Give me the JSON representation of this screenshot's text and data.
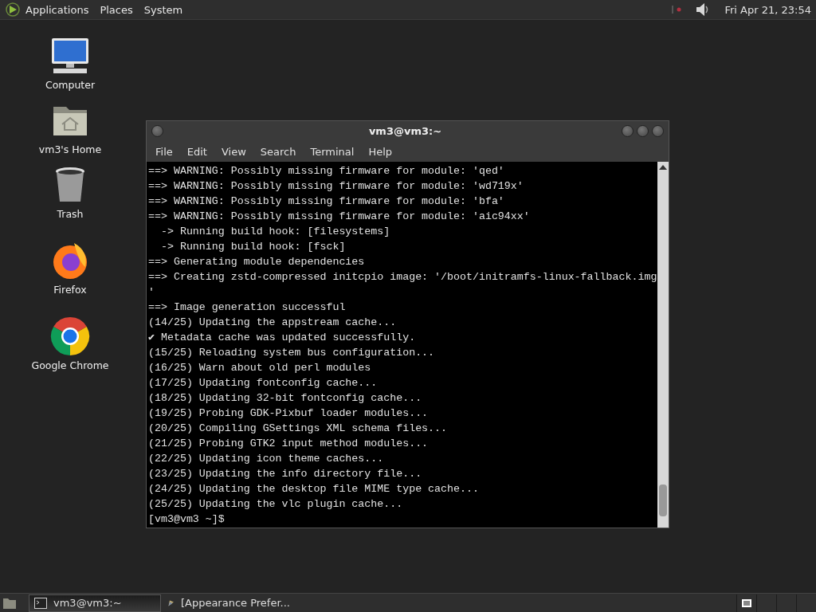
{
  "top_panel": {
    "menus": [
      {
        "label": "Applications"
      },
      {
        "label": "Places"
      },
      {
        "label": "System"
      }
    ],
    "clock": "Fri Apr 21, 23:54"
  },
  "desktop_icons": [
    {
      "label": "Computer",
      "kind": "computer"
    },
    {
      "label": "vm3's Home",
      "kind": "home"
    },
    {
      "label": "Trash",
      "kind": "trash"
    },
    {
      "label": "Firefox",
      "kind": "firefox"
    },
    {
      "label": "Google Chrome",
      "kind": "chrome"
    }
  ],
  "window": {
    "title": "vm3@vm3:~",
    "menu": [
      "File",
      "Edit",
      "View",
      "Search",
      "Terminal",
      "Help"
    ],
    "lines": [
      "==> WARNING: Possibly missing firmware for module: 'qed'",
      "==> WARNING: Possibly missing firmware for module: 'wd719x'",
      "==> WARNING: Possibly missing firmware for module: 'bfa'",
      "==> WARNING: Possibly missing firmware for module: 'aic94xx'",
      "  -> Running build hook: [filesystems]",
      "  -> Running build hook: [fsck]",
      "==> Generating module dependencies",
      "==> Creating zstd-compressed initcpio image: '/boot/initramfs-linux-fallback.img",
      "'",
      "==> Image generation successful",
      "(14/25) Updating the appstream cache...",
      "✔ Metadata cache was updated successfully.",
      "(15/25) Reloading system bus configuration...",
      "(16/25) Warn about old perl modules",
      "(17/25) Updating fontconfig cache...",
      "(18/25) Updating 32-bit fontconfig cache...",
      "(19/25) Probing GDK-Pixbuf loader modules...",
      "(20/25) Compiling GSettings XML schema files...",
      "(21/25) Probing GTK2 input method modules...",
      "(22/25) Updating icon theme caches...",
      "(23/25) Updating the info directory file...",
      "(24/25) Updating the desktop file MIME type cache...",
      "(25/25) Updating the vlc plugin cache...",
      "[vm3@vm3 ~]$"
    ]
  },
  "taskbar": {
    "tasks": [
      {
        "label": "vm3@vm3:~",
        "kind": "terminal",
        "selected": true
      },
      {
        "label": "[Appearance Prefer...",
        "kind": "appearance",
        "selected": false
      }
    ],
    "workspaces": [
      {
        "selected": true
      },
      {
        "selected": false
      },
      {
        "selected": false
      },
      {
        "selected": false
      }
    ]
  }
}
